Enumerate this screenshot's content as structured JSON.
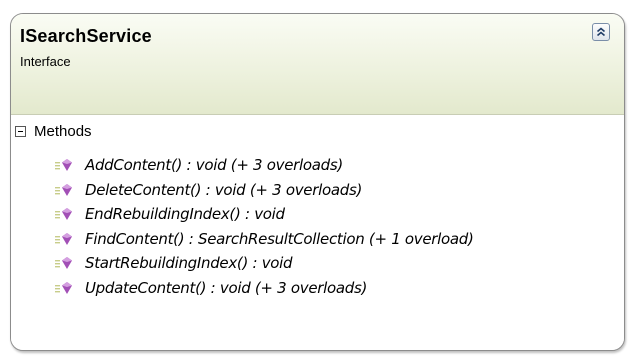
{
  "type": {
    "name": "ISearchService",
    "stereotype": "Interface"
  },
  "section": {
    "label": "Methods",
    "expanded": true
  },
  "methods": [
    "AddContent() : void (+ 3 overloads)",
    "DeleteContent() : void (+ 3 overloads)",
    "EndRebuildingIndex() : void",
    "FindContent() : SearchResultCollection (+ 1 overload)",
    "StartRebuildingIndex() : void",
    "UpdateContent() : void (+ 3 overloads)"
  ],
  "icons": {
    "collapse": "chevron-double-up-icon",
    "section_toggle": "minus-box-icon",
    "method": "method-icon"
  },
  "colors": {
    "header_top": "#fafcf4",
    "header_bottom": "#e3e9cd",
    "method_icon": "#a24fb6"
  }
}
